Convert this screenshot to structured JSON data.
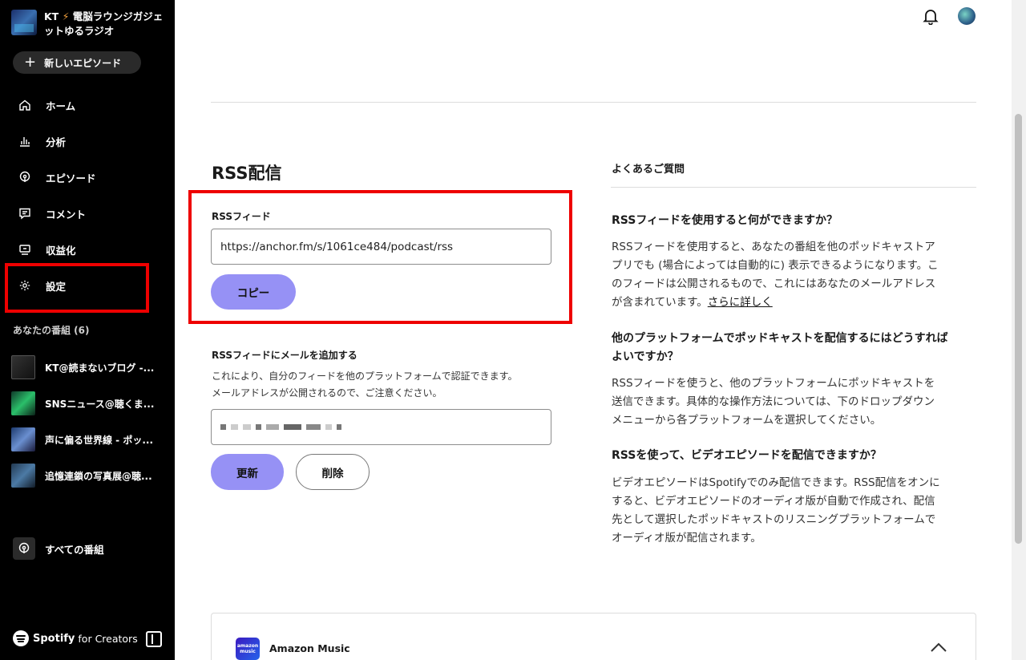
{
  "sidebar": {
    "show_title_prefix": "KT",
    "show_title_rest": "電脳ラウンジガジェットゆるラジオ",
    "new_episode_label": "新しいエピソード",
    "nav": [
      {
        "label": "ホーム",
        "icon": "home-icon"
      },
      {
        "label": "分析",
        "icon": "analytics-icon"
      },
      {
        "label": "エピソード",
        "icon": "podcast-icon"
      },
      {
        "label": "コメント",
        "icon": "comment-icon"
      },
      {
        "label": "収益化",
        "icon": "monetize-icon"
      },
      {
        "label": "設定",
        "icon": "gear-icon"
      }
    ],
    "shows_header": "あなたの番組 (6)",
    "shows": [
      {
        "label": "KT@読まないブログ -..."
      },
      {
        "label": "SNSニュース@聴くま..."
      },
      {
        "label": "声に偏る世界線 - ポッ..."
      },
      {
        "label": "追憶連鎖の写真展@聴..."
      }
    ],
    "all_shows_label": "すべての番組",
    "brand_name": "Spotify",
    "brand_suffix": "for Creators"
  },
  "main": {
    "rss_title": "RSS配信",
    "rss_feed_label": "RSSフィード",
    "rss_feed_url": "https://anchor.fm/s/1061ce484/podcast/rss",
    "copy_label": "コピー",
    "email_title": "RSSフィードにメールを追加する",
    "email_desc_1": "これにより、自分のフィードを他のプラットフォームで認証できます。",
    "email_desc_2": "メールアドレスが公開されるので、ご注意ください。",
    "update_label": "更新",
    "delete_label": "削除"
  },
  "faq": {
    "header": "よくあるご質問",
    "q1": "RSSフィードを使用すると何ができますか？",
    "a1_l1": "RSSフィードを使用すると、あなたの番組を他のポッドキャストア",
    "a1_l2": "プリでも (場合によっては自動的に) 表示できるようになります。こ",
    "a1_l3": "のフィードは公開されるもので、これにはあなたのメールアドレス",
    "a1_l4": "が含まれています。",
    "a1_link": "さらに詳しく",
    "q2_l1": "他のプラットフォームでポッドキャストを配信するにはどうすれば",
    "q2_l2": "よいですか？",
    "a2_l1": "RSSフィードを使うと、他のプラットフォームにポッドキャストを",
    "a2_l2": "送信できます。具体的な操作方法については、下のドロップダウン",
    "a2_l3": "メニューから各プラットフォームを選択してください。",
    "q3": "RSSを使って、ビデオエピソードを配信できますか？",
    "a3_l1": "ビデオエピソードはSpotifyでのみ配信できます。RSS配信をオンに",
    "a3_l2": "すると、ビデオエピソードのオーディオ版が自動で作成され、配信",
    "a3_l3": "先として選択したポッドキャストのリスニングプラットフォームで",
    "a3_l4": "オーディオ版が配信されます。"
  },
  "platform": {
    "logo_line1": "amazon",
    "logo_line2": "music",
    "name": "Amazon Music"
  },
  "colors": {
    "sidebar_bg": "#000000",
    "accent_button": "#9691f5",
    "highlight_box": "#ee0000"
  }
}
